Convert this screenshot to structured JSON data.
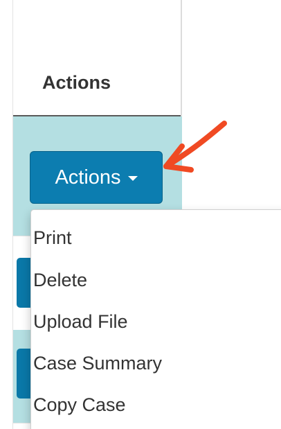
{
  "table": {
    "column_header": "Actions"
  },
  "actions_button": {
    "label": "Actions",
    "color": "#0c7db0"
  },
  "dropdown": {
    "items": [
      {
        "label": "Print"
      },
      {
        "label": "Delete"
      },
      {
        "label": "Upload File"
      },
      {
        "label": "Case Summary"
      },
      {
        "label": "Copy Case"
      }
    ]
  },
  "annotation": {
    "arrow_color": "#f04a23"
  },
  "colors": {
    "row_highlight": "#b4dfe2",
    "button_blue": "#0c7db0"
  }
}
